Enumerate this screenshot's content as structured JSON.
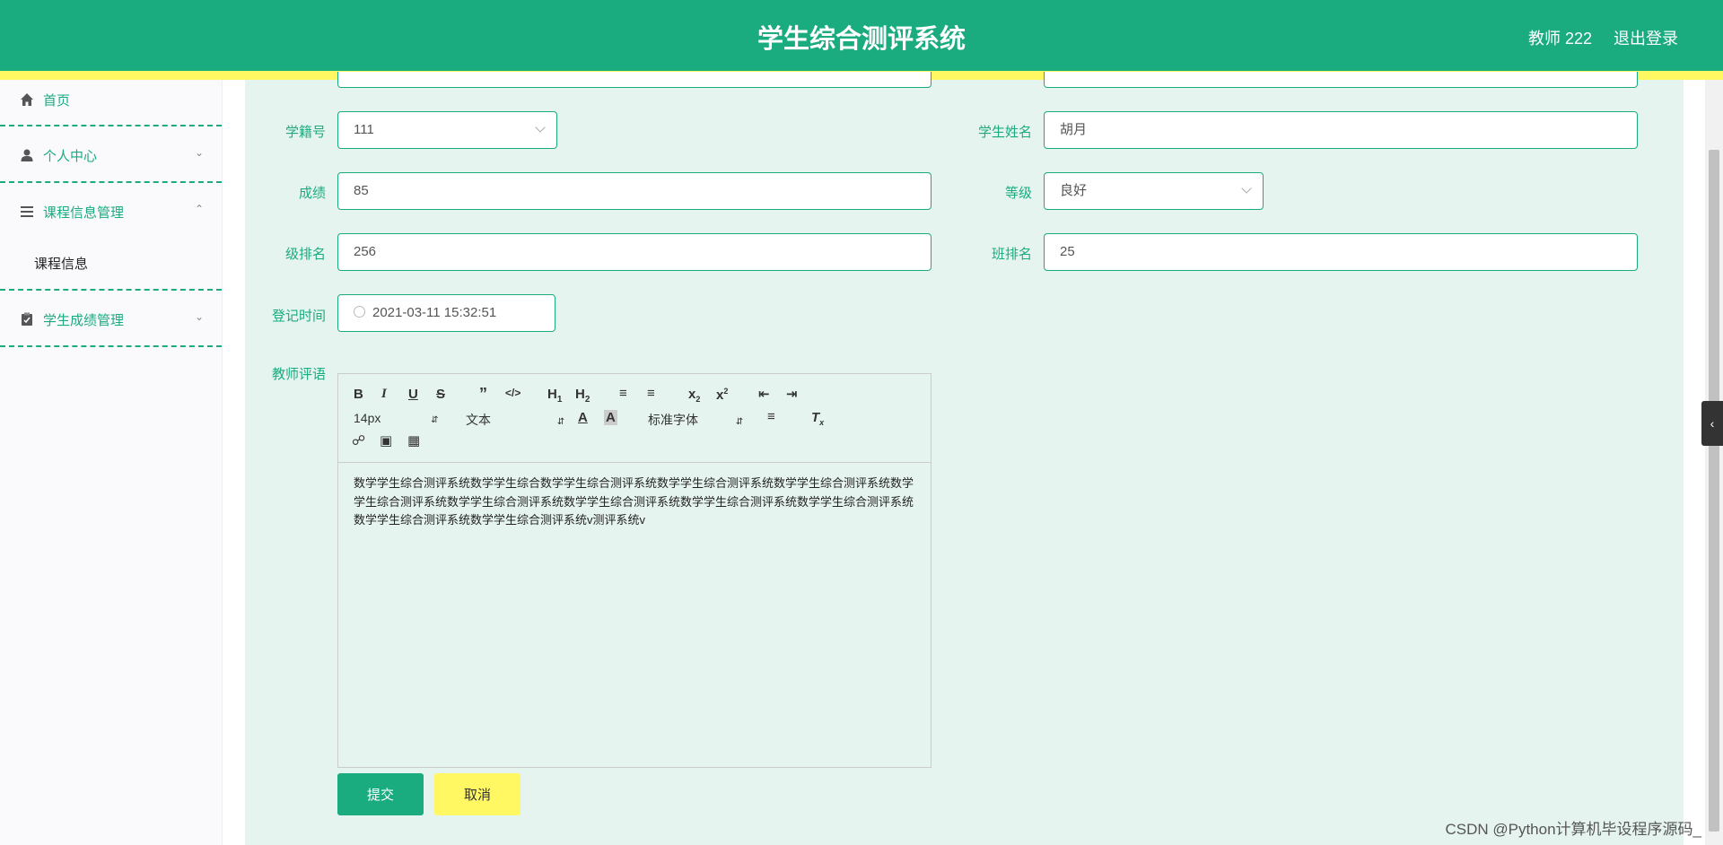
{
  "header": {
    "title": "学生综合测评系统",
    "user_label": "教师 222",
    "logout_label": "退出登录"
  },
  "sidebar": {
    "items": [
      {
        "label": "首页",
        "icon": "home-icon"
      },
      {
        "label": "个人中心",
        "icon": "user-icon"
      },
      {
        "label": "课程信息管理",
        "icon": "list-icon"
      },
      {
        "label": "学生成绩管理",
        "icon": "clipboard-icon"
      }
    ],
    "submenu_label": "课程信息"
  },
  "form": {
    "student_id_label": "学籍号",
    "student_id_value": "111",
    "student_name_label": "学生姓名",
    "student_name_value": "胡月",
    "score_label": "成绩",
    "score_value": "85",
    "grade_label": "等级",
    "grade_value": "良好",
    "grade_rank_label": "级排名",
    "grade_rank_value": "256",
    "class_rank_label": "班排名",
    "class_rank_value": "25",
    "register_time_label": "登记时间",
    "register_time_value": "2021-03-11 15:32:51",
    "comment_label": "教师评语"
  },
  "editor": {
    "font_size": "14px",
    "text_type": "文本",
    "font_family": "标准字体",
    "content": "数学学生综合测评系统数学学生综合数学学生综合测评系统数学学生综合测评系统数学学生综合测评系统数学学生综合测评系统数学学生综合测评系统数学学生综合测评系统数学学生综合测评系统数学学生综合测评系统数学学生综合测评系统数学学生综合测评系统v测评系统v"
  },
  "buttons": {
    "submit_label": "提交",
    "cancel_label": "取消"
  },
  "watermark": "CSDN @Python计算机毕设程序源码_",
  "colors": {
    "primary": "#1aab7f",
    "accent_yellow": "#fff863",
    "content_bg": "#e6f4ef"
  }
}
